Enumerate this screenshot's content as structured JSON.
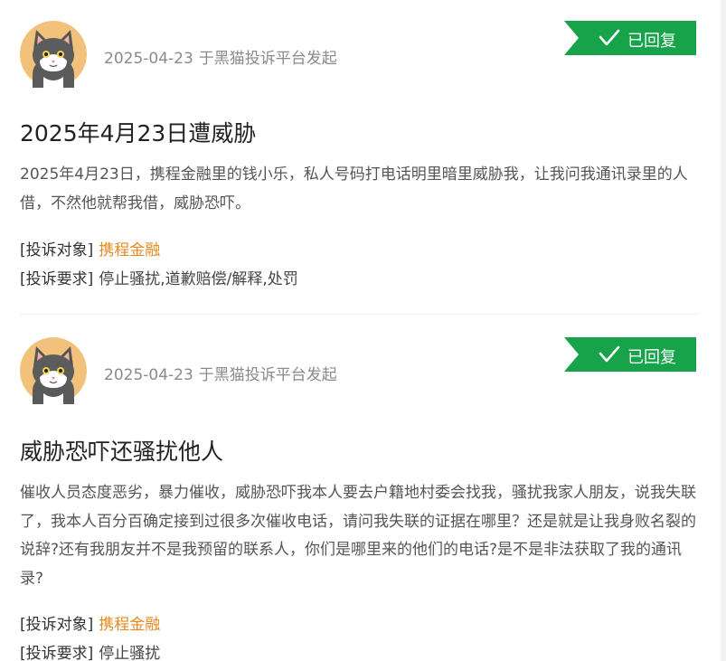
{
  "colors": {
    "accent_green": "#16a34a",
    "link_orange": "#e58a20",
    "meta_gray": "#8a8a8a",
    "text_dark": "#222222"
  },
  "complaints": [
    {
      "avatar_icon": "cat-avatar-icon",
      "date": "2025-04-23",
      "source": "于黑猫投诉平台发起",
      "status": "已回复",
      "status_icon": "checkmark-icon",
      "title": "2025年4月23日遭威胁",
      "description": "2025年4月23日，携程金融里的钱小乐，私人号码打电话明里暗里威胁我，让我问我通讯录里的人借，不然他就帮我借，威胁恐吓。",
      "target_label": "[投诉对象]",
      "target": "携程金融",
      "demand_label": "[投诉要求]",
      "demand": "停止骚扰,道歉赔偿/解释,处罚"
    },
    {
      "avatar_icon": "cat-avatar-icon",
      "date": "2025-04-23",
      "source": "于黑猫投诉平台发起",
      "status": "已回复",
      "status_icon": "checkmark-icon",
      "title": "威胁恐吓还骚扰他人",
      "description": "催收人员态度恶劣，暴力催收，威胁恐吓我本人要去户籍地村委会找我，骚扰我家人朋友，说我失联了，我本人百分百确定接到过很多次催收电话，请问我失联的证据在哪里？还是就是让我身败名裂的说辞?还有我朋友并不是我预留的联系人，你们是哪里来的他们的电话?是不是非法获取了我的通讯录?",
      "target_label": "[投诉对象]",
      "target": "携程金融",
      "demand_label": "[投诉要求]",
      "demand": "停止骚扰"
    }
  ]
}
